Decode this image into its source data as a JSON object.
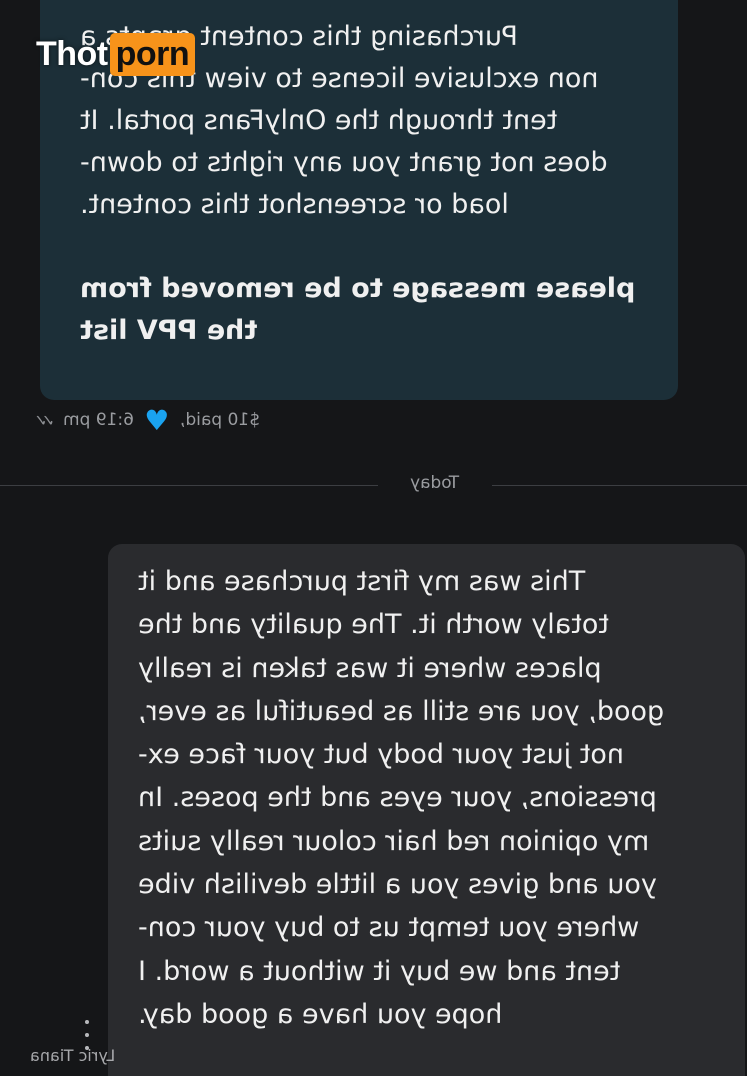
{
  "watermark": {
    "part1": "Thot",
    "part2": "porn",
    "accent": "#f7931a"
  },
  "top_message": {
    "lines": [
      "Purchasing this content grants a",
      "non exclusive license to view this con-",
      "tent through the OnlyFans portal. It",
      "does not grant you any rights to down-",
      "load or screenshot this content."
    ],
    "bold_lines": [
      "please message to be removed from",
      "the PPV list"
    ],
    "price": "$10 paid,",
    "time": "6:19 pm",
    "heart_color": "#1aa3f0",
    "heart_icon": "heart-icon",
    "read_icon": "double-check-icon"
  },
  "divider": {
    "label": "Today"
  },
  "bottom_message": {
    "lines": [
      "This was my first purchase and it",
      "totaly worth it. The quality and the",
      "places where it was taken is really",
      "good, you are still as beautiful as ever,",
      "not just your body but your face ex-",
      "pressions, your eyes and the poses. In",
      "my opinion red hair colour really suits",
      "you and gives you a little devilish vibe",
      "where you tempt us to buy your con-",
      "tent and we buy it without a word. I",
      "hope you have a good day."
    ],
    "sender": "Lyric Tiana",
    "more_icon": "more-vertical-icon"
  }
}
